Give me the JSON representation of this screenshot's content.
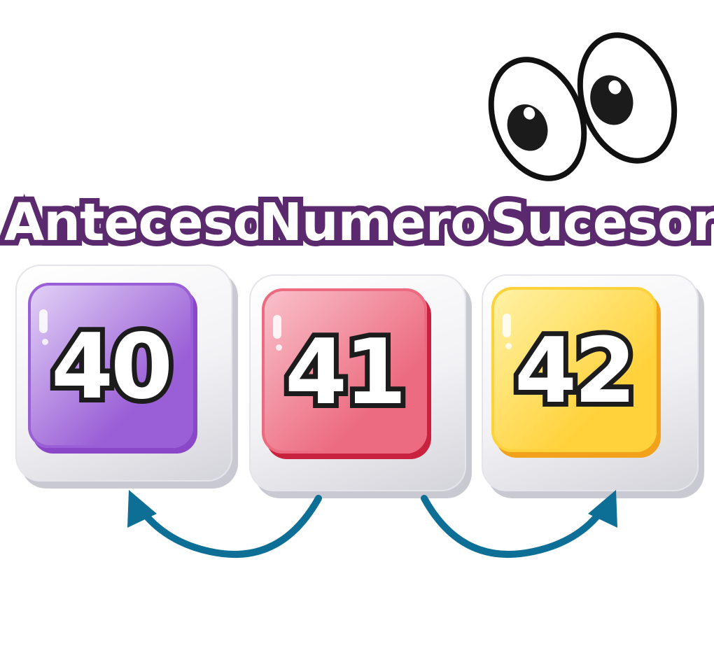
{
  "labels": {
    "antecesor": "Antecesor",
    "numero": "Numero",
    "sucesor": "Sucesor"
  },
  "tiles": [
    {
      "value": "40",
      "role": "antecesor",
      "color_light": "#e3d3f7",
      "color_dark": "#9a5fd6",
      "edge": "#8a48c8"
    },
    {
      "value": "41",
      "role": "numero",
      "color_light": "#f9c3cc",
      "color_dark": "#ec6b80",
      "edge": "#c8223f"
    },
    {
      "value": "42",
      "role": "sucesor",
      "color_light": "#fff3a8",
      "color_dark": "#ffd23c",
      "edge": "#f2a21a"
    }
  ],
  "colors": {
    "label_outline": "#5b2a6e",
    "arrow": "#0e6f96",
    "number_outline": "#1c1c1c"
  },
  "icons": {
    "eyes": "cartoon-eyes-icon",
    "left_arrow": "curved-arrow-left-icon",
    "right_arrow": "curved-arrow-right-icon"
  }
}
